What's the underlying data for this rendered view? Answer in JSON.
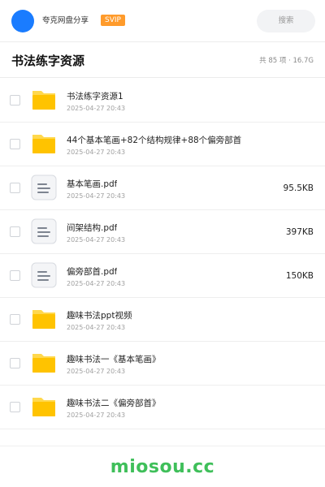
{
  "header": {
    "brand": "夸克网盘分享",
    "badge": "SVIP",
    "search_label": "搜索"
  },
  "folder": {
    "title": "书法练字资源",
    "meta": "共 85 项 · 16.7G"
  },
  "files": [
    {
      "type": "folder",
      "icon": "folder-icon",
      "name": "书法练字资源1",
      "date": "2025-04-27 20:43",
      "size": ""
    },
    {
      "type": "folder",
      "icon": "folder-icon",
      "name": "44个基本笔画+82个结构规律+88个偏旁部首",
      "date": "2025-04-27 20:43",
      "size": ""
    },
    {
      "type": "pdf",
      "icon": "document-icon",
      "name": "基本笔画.pdf",
      "date": "2025-04-27 20:43",
      "size": "95.5KB"
    },
    {
      "type": "pdf",
      "icon": "document-icon",
      "name": "间架结构.pdf",
      "date": "2025-04-27 20:43",
      "size": "397KB"
    },
    {
      "type": "pdf",
      "icon": "document-icon",
      "name": "偏旁部首.pdf",
      "date": "2025-04-27 20:43",
      "size": "150KB"
    },
    {
      "type": "folder",
      "icon": "folder-icon",
      "name": "趣味书法ppt视频",
      "date": "2025-04-27 20:43",
      "size": ""
    },
    {
      "type": "folder",
      "icon": "folder-icon",
      "name": "趣味书法一《基本笔画》",
      "date": "2025-04-27 20:43",
      "size": ""
    },
    {
      "type": "folder",
      "icon": "folder-icon",
      "name": "趣味书法二《偏旁部首》",
      "date": "2025-04-27 20:43",
      "size": ""
    }
  ],
  "watermark": "miosou.cc",
  "colors": {
    "accent": "#1a7cff",
    "badge": "#ff9b2b",
    "folder": "#ffc300",
    "watermark": "#3fbf5a"
  }
}
